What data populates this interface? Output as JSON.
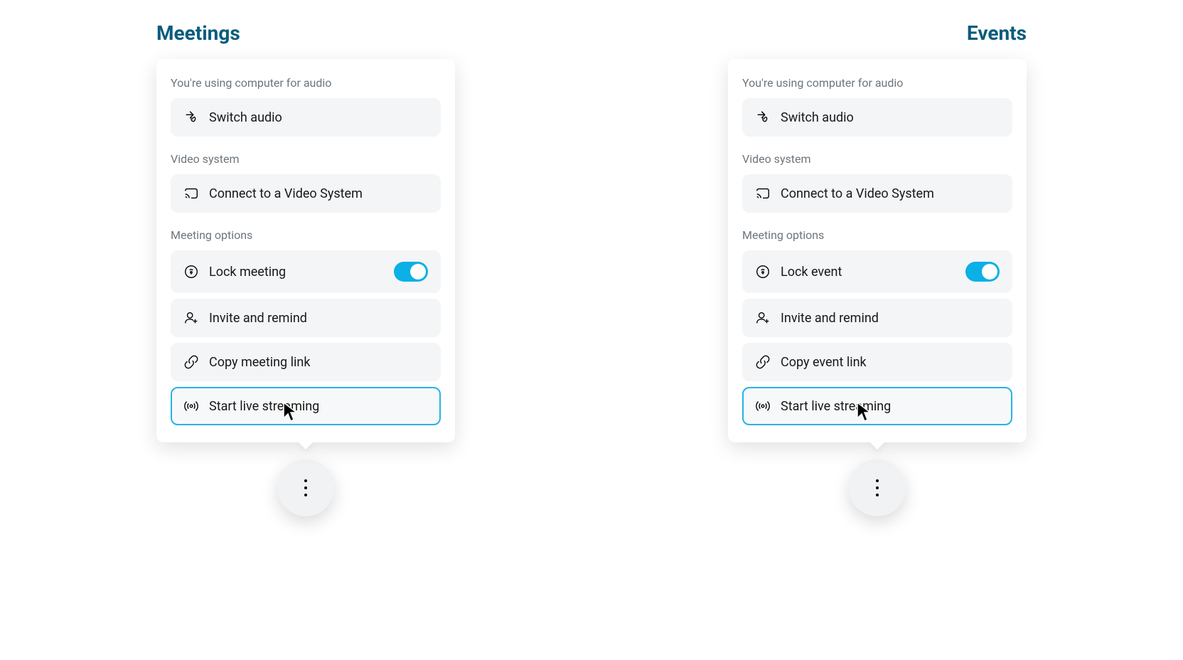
{
  "left": {
    "title": "Meetings",
    "audio_label": "You're using computer for audio",
    "switch_audio": "Switch audio",
    "video_system_label": "Video system",
    "connect_video": "Connect to a Video System",
    "meeting_options_label": "Meeting options",
    "lock": "Lock meeting",
    "invite": "Invite and remind",
    "copy_link": "Copy meeting link",
    "start_streaming": "Start live streaming"
  },
  "right": {
    "title": "Events",
    "audio_label": "You're using computer for audio",
    "switch_audio": "Switch audio",
    "video_system_label": "Video system",
    "connect_video": "Connect to a Video System",
    "meeting_options_label": "Meeting options",
    "lock": "Lock event",
    "invite": "Invite and remind",
    "copy_link": "Copy event link",
    "start_streaming": "Start live streaming"
  }
}
